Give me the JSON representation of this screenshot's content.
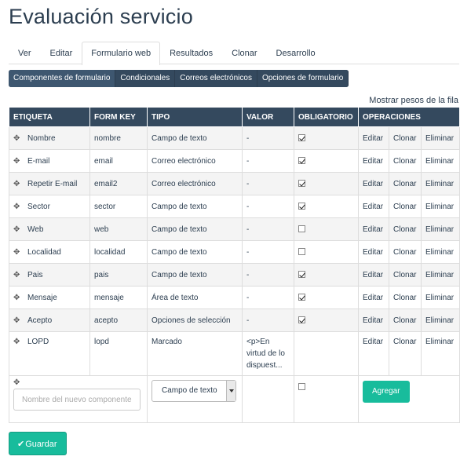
{
  "page_title": "Evaluación servicio",
  "tabs": [
    {
      "label": "Ver"
    },
    {
      "label": "Editar"
    },
    {
      "label": "Formulario web",
      "active": true
    },
    {
      "label": "Resultados"
    },
    {
      "label": "Clonar"
    },
    {
      "label": "Desarrollo"
    }
  ],
  "subtabs": [
    {
      "label": "Componentes de formulario",
      "active": true
    },
    {
      "label": "Condicionales"
    },
    {
      "label": "Correos electrónicos"
    },
    {
      "label": "Opciones de formulario"
    }
  ],
  "row_weights_link": "Mostrar pesos de la fila",
  "table": {
    "headers": [
      "ETIQUETA",
      "FORM KEY",
      "TIPO",
      "VALOR",
      "OBLIGATORIO",
      "OPERACIONES"
    ],
    "op_labels": {
      "edit": "Editar",
      "clone": "Clonar",
      "delete": "Eliminar"
    },
    "rows": [
      {
        "label": "Nombre",
        "key": "nombre",
        "type": "Campo de texto",
        "value": "-",
        "required": true
      },
      {
        "label": "E-mail",
        "key": "email",
        "type": "Correo electrónico",
        "value": "-",
        "required": true
      },
      {
        "label": "Repetir E-mail",
        "key": "email2",
        "type": "Correo electrónico",
        "value": "-",
        "required": true
      },
      {
        "label": "Sector",
        "key": "sector",
        "type": "Campo de texto",
        "value": "-",
        "required": true
      },
      {
        "label": "Web",
        "key": "web",
        "type": "Campo de texto",
        "value": "-",
        "required": false
      },
      {
        "label": "Localidad",
        "key": "localidad",
        "type": "Campo de texto",
        "value": "-",
        "required": false
      },
      {
        "label": "Pais",
        "key": "pais",
        "type": "Campo de texto",
        "value": "-",
        "required": true
      },
      {
        "label": "Mensaje",
        "key": "mensaje",
        "type": "Área de texto",
        "value": "-",
        "required": true
      },
      {
        "label": "Acepto",
        "key": "acepto",
        "type": "Opciones de selección",
        "value": "-",
        "required": true
      },
      {
        "label": "LOPD",
        "key": "lopd",
        "type": "Marcado",
        "value": "<p>En virtud de lo dispuest...",
        "required": null
      }
    ]
  },
  "new_component": {
    "placeholder": "Nombre del nuevo componente",
    "type_selected": "Campo de texto",
    "required": false,
    "add_label": "Agregar"
  },
  "save_label": "Guardar",
  "colors": {
    "header_bg": "#34495e",
    "accent": "#18bc9c"
  },
  "icons": {
    "drag": "move-icon",
    "save": "check-icon"
  }
}
